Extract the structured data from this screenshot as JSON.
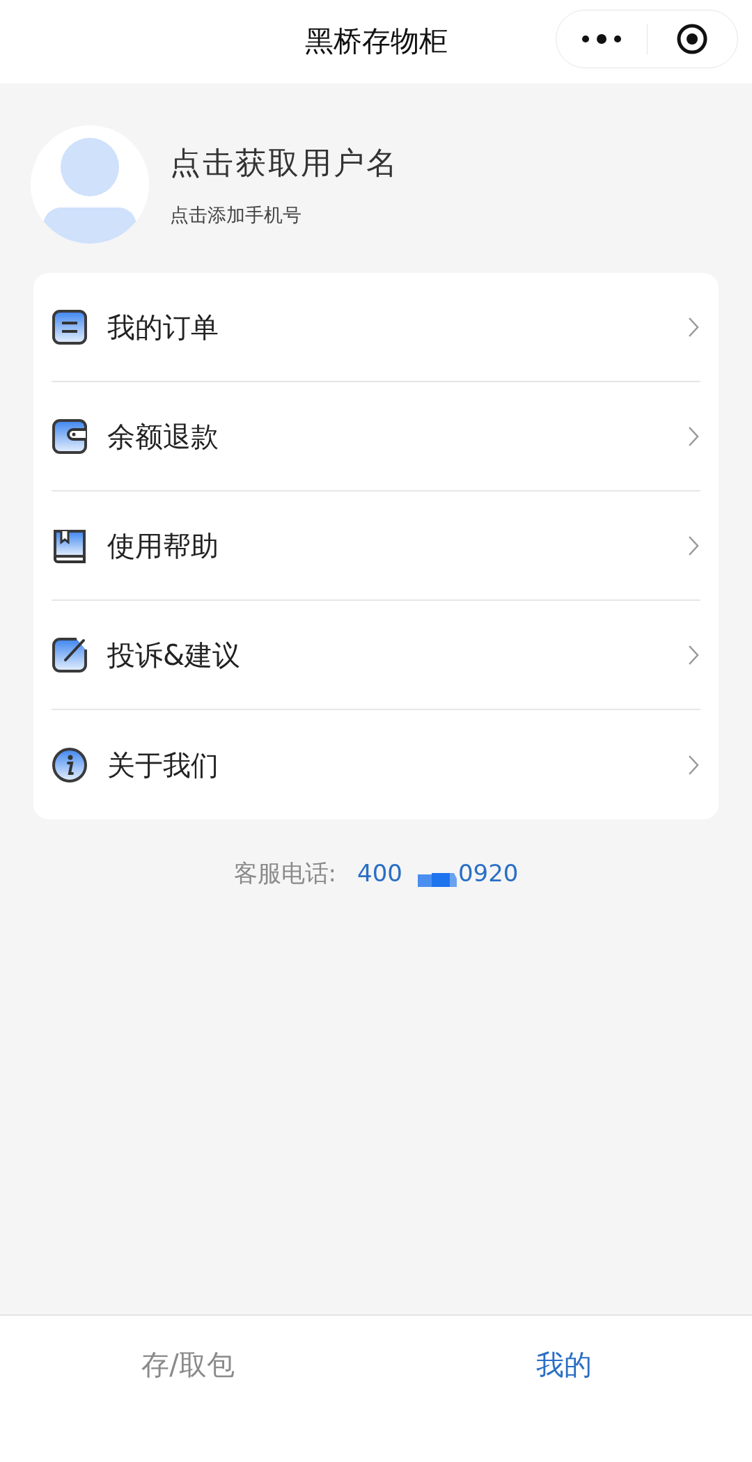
{
  "nav_bar": {
    "title": "黑桥存物柜"
  },
  "profile": {
    "name": "点击获取用户名",
    "phone_hint": "点击添加手机号"
  },
  "menu": [
    {
      "label": "我的订单"
    },
    {
      "label": "余额退款"
    },
    {
      "label": "使用帮助"
    },
    {
      "label": "投诉&建议"
    },
    {
      "label": "关于我们"
    }
  ],
  "contact": {
    "label": "客服电话:",
    "phone_start": "400",
    "phone_end": "0920"
  },
  "tab_bar": [
    {
      "label": "存/取包",
      "selected": false
    },
    {
      "label": "我的",
      "selected": true
    }
  ]
}
